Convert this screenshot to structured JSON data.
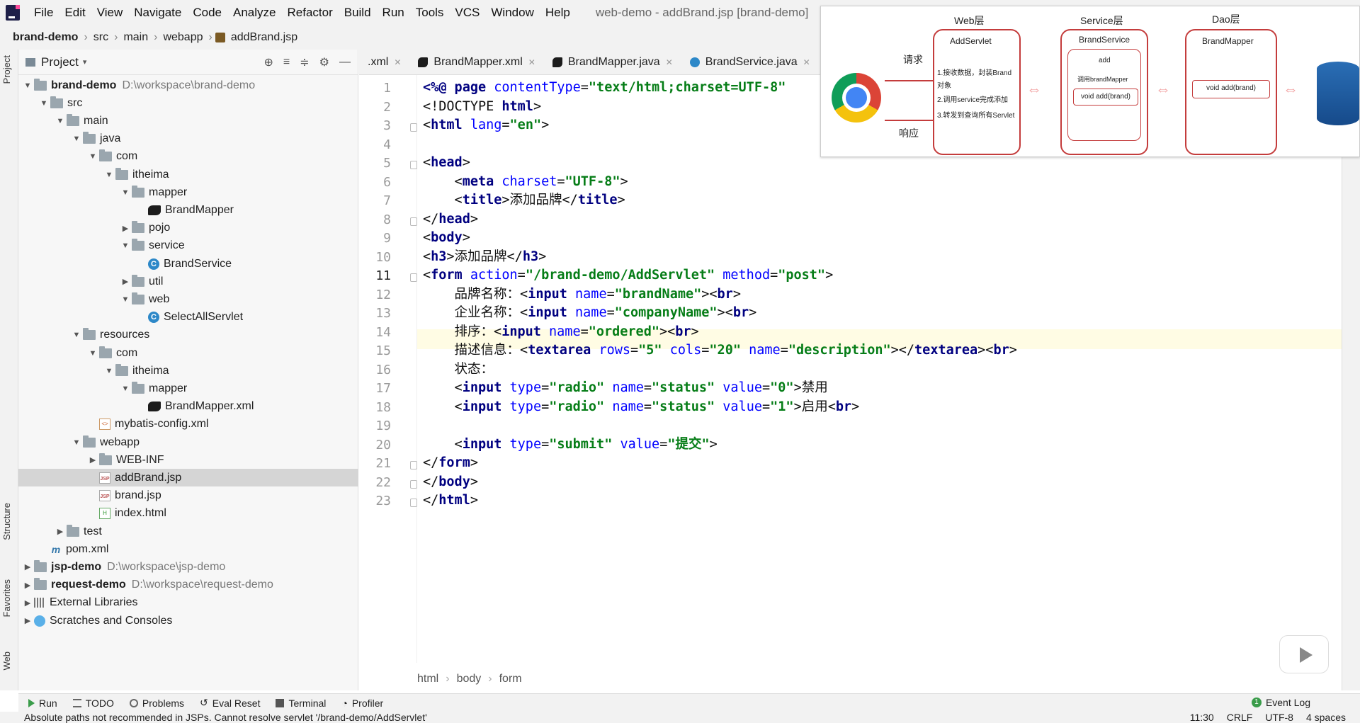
{
  "menubar": {
    "items": [
      "File",
      "Edit",
      "View",
      "Navigate",
      "Code",
      "Analyze",
      "Refactor",
      "Build",
      "Run",
      "Tools",
      "VCS",
      "Window",
      "Help"
    ],
    "window_title": "web-demo - addBrand.jsp [brand-demo]"
  },
  "navbar": {
    "crumbs": [
      "brand-demo",
      "src",
      "main",
      "webapp",
      "addBrand.jsp"
    ]
  },
  "left_stripe": {
    "labels": [
      "Project",
      "Structure",
      "Favorites",
      "Web"
    ]
  },
  "project": {
    "title": "Project",
    "tree": [
      {
        "label": "brand-demo",
        "muted": "D:\\workspace\\brand-demo",
        "icon": "folder",
        "depth": 0,
        "arrow": "down",
        "bold": true
      },
      {
        "label": "src",
        "icon": "folder",
        "depth": 1,
        "arrow": "down"
      },
      {
        "label": "main",
        "icon": "folder",
        "depth": 2,
        "arrow": "down"
      },
      {
        "label": "java",
        "icon": "folder",
        "depth": 3,
        "arrow": "down"
      },
      {
        "label": "com",
        "icon": "folder",
        "depth": 4,
        "arrow": "down"
      },
      {
        "label": "itheima",
        "icon": "folder",
        "depth": 5,
        "arrow": "down"
      },
      {
        "label": "mapper",
        "icon": "folder",
        "depth": 6,
        "arrow": "down"
      },
      {
        "label": "BrandMapper",
        "icon": "bird",
        "depth": 7,
        "arrow": ""
      },
      {
        "label": "pojo",
        "icon": "folder",
        "depth": 6,
        "arrow": "right"
      },
      {
        "label": "service",
        "icon": "folder",
        "depth": 6,
        "arrow": "down"
      },
      {
        "label": "BrandService",
        "icon": "class",
        "depth": 7,
        "arrow": ""
      },
      {
        "label": "util",
        "icon": "folder",
        "depth": 6,
        "arrow": "right"
      },
      {
        "label": "web",
        "icon": "folder",
        "depth": 6,
        "arrow": "down"
      },
      {
        "label": "SelectAllServlet",
        "icon": "class",
        "depth": 7,
        "arrow": ""
      },
      {
        "label": "resources",
        "icon": "folder",
        "depth": 3,
        "arrow": "down"
      },
      {
        "label": "com",
        "icon": "folder",
        "depth": 4,
        "arrow": "down"
      },
      {
        "label": "itheima",
        "icon": "folder",
        "depth": 5,
        "arrow": "down"
      },
      {
        "label": "mapper",
        "icon": "folder",
        "depth": 6,
        "arrow": "down"
      },
      {
        "label": "BrandMapper.xml",
        "icon": "bird",
        "depth": 7,
        "arrow": ""
      },
      {
        "label": "mybatis-config.xml",
        "icon": "xml",
        "depth": 4,
        "arrow": ""
      },
      {
        "label": "webapp",
        "icon": "folder",
        "depth": 3,
        "arrow": "down"
      },
      {
        "label": "WEB-INF",
        "icon": "folder",
        "depth": 4,
        "arrow": "right"
      },
      {
        "label": "addBrand.jsp",
        "icon": "jsp",
        "depth": 4,
        "arrow": "",
        "selected": true
      },
      {
        "label": "brand.jsp",
        "icon": "jsp",
        "depth": 4,
        "arrow": ""
      },
      {
        "label": "index.html",
        "icon": "html",
        "depth": 4,
        "arrow": ""
      },
      {
        "label": "test",
        "icon": "folder",
        "depth": 2,
        "arrow": "right"
      },
      {
        "label": "pom.xml",
        "icon": "m",
        "depth": 1,
        "arrow": ""
      },
      {
        "label": "jsp-demo",
        "muted": "D:\\workspace\\jsp-demo",
        "icon": "folder",
        "depth": 0,
        "arrow": "right",
        "bold": true
      },
      {
        "label": "request-demo",
        "muted": "D:\\workspace\\request-demo",
        "icon": "folder",
        "depth": 0,
        "arrow": "right",
        "bold": true
      },
      {
        "label": "External Libraries",
        "icon": "lib",
        "depth": 0,
        "arrow": "right"
      },
      {
        "label": "Scratches and Consoles",
        "icon": "scratch",
        "depth": 0,
        "arrow": "right"
      }
    ]
  },
  "tabs": [
    {
      "label": ".xml"
    },
    {
      "label": "BrandMapper.xml"
    },
    {
      "label": "BrandMapper.java"
    },
    {
      "label": "BrandService.java"
    }
  ],
  "editor": {
    "current_line": 11,
    "lines": [
      [
        [
          "tag",
          "<%@ page "
        ],
        [
          "attr",
          "contentType"
        ],
        [
          "txt",
          "="
        ],
        [
          "val",
          "\"text/html;charset=UTF-8\""
        ]
      ],
      [
        [
          "txt",
          "<!DOCTYPE "
        ],
        [
          "tag",
          "html"
        ],
        [
          "txt",
          ">"
        ]
      ],
      [
        [
          "txt",
          "<"
        ],
        [
          "tag",
          "html "
        ],
        [
          "attr",
          "lang"
        ],
        [
          "txt",
          "="
        ],
        [
          "val",
          "\"en\""
        ],
        [
          "txt",
          ">"
        ]
      ],
      [],
      [
        [
          "txt",
          "<"
        ],
        [
          "tag",
          "head"
        ],
        [
          "txt",
          ">"
        ]
      ],
      [
        [
          "txt",
          "    <"
        ],
        [
          "tag",
          "meta "
        ],
        [
          "attr",
          "charset"
        ],
        [
          "txt",
          "="
        ],
        [
          "val",
          "\"UTF-8\""
        ],
        [
          "txt",
          ">"
        ]
      ],
      [
        [
          "txt",
          "    <"
        ],
        [
          "tag",
          "title"
        ],
        [
          "txt",
          ">添加品牌</"
        ],
        [
          "tag",
          "title"
        ],
        [
          "txt",
          ">"
        ]
      ],
      [
        [
          "txt",
          "</"
        ],
        [
          "tag",
          "head"
        ],
        [
          "txt",
          ">"
        ]
      ],
      [
        [
          "txt",
          "<"
        ],
        [
          "tag",
          "body"
        ],
        [
          "txt",
          ">"
        ]
      ],
      [
        [
          "txt",
          "<"
        ],
        [
          "tag",
          "h3"
        ],
        [
          "txt",
          ">添加品牌</"
        ],
        [
          "tag",
          "h3"
        ],
        [
          "txt",
          ">"
        ]
      ],
      [
        [
          "txt",
          "<"
        ],
        [
          "tag",
          "form "
        ],
        [
          "attr",
          "action"
        ],
        [
          "txt",
          "="
        ],
        [
          "val",
          "\"/brand-demo/AddServlet\""
        ],
        [
          "txt",
          " "
        ],
        [
          "attr",
          "method"
        ],
        [
          "txt",
          "="
        ],
        [
          "val",
          "\"post\""
        ],
        [
          "txt",
          ">"
        ]
      ],
      [
        [
          "txt",
          "    品牌名称：<"
        ],
        [
          "tag",
          "input "
        ],
        [
          "attr",
          "name"
        ],
        [
          "txt",
          "="
        ],
        [
          "val",
          "\"brandName\""
        ],
        [
          "txt",
          "><"
        ],
        [
          "tag",
          "br"
        ],
        [
          "txt",
          ">"
        ]
      ],
      [
        [
          "txt",
          "    企业名称：<"
        ],
        [
          "tag",
          "input "
        ],
        [
          "attr",
          "name"
        ],
        [
          "txt",
          "="
        ],
        [
          "val",
          "\"companyName\""
        ],
        [
          "txt",
          "><"
        ],
        [
          "tag",
          "br"
        ],
        [
          "txt",
          ">"
        ]
      ],
      [
        [
          "txt",
          "    排序：<"
        ],
        [
          "tag",
          "input "
        ],
        [
          "attr",
          "name"
        ],
        [
          "txt",
          "="
        ],
        [
          "val",
          "\"ordered\""
        ],
        [
          "txt",
          "><"
        ],
        [
          "tag",
          "br"
        ],
        [
          "txt",
          ">"
        ]
      ],
      [
        [
          "txt",
          "    描述信息：<"
        ],
        [
          "tag",
          "textarea "
        ],
        [
          "attr",
          "rows"
        ],
        [
          "txt",
          "="
        ],
        [
          "val",
          "\"5\""
        ],
        [
          "txt",
          " "
        ],
        [
          "attr",
          "cols"
        ],
        [
          "txt",
          "="
        ],
        [
          "val",
          "\"20\""
        ],
        [
          "txt",
          " "
        ],
        [
          "attr",
          "name"
        ],
        [
          "txt",
          "="
        ],
        [
          "val",
          "\"description\""
        ],
        [
          "txt",
          "></"
        ],
        [
          "tag",
          "textarea"
        ],
        [
          "txt",
          "><"
        ],
        [
          "tag",
          "br"
        ],
        [
          "txt",
          ">"
        ]
      ],
      [
        [
          "txt",
          "    状态："
        ]
      ],
      [
        [
          "txt",
          "    <"
        ],
        [
          "tag",
          "input "
        ],
        [
          "attr",
          "type"
        ],
        [
          "txt",
          "="
        ],
        [
          "val",
          "\"radio\""
        ],
        [
          "txt",
          " "
        ],
        [
          "attr",
          "name"
        ],
        [
          "txt",
          "="
        ],
        [
          "val",
          "\"status\""
        ],
        [
          "txt",
          " "
        ],
        [
          "attr",
          "value"
        ],
        [
          "txt",
          "="
        ],
        [
          "val",
          "\"0\""
        ],
        [
          "txt",
          ">禁用"
        ]
      ],
      [
        [
          "txt",
          "    <"
        ],
        [
          "tag",
          "input "
        ],
        [
          "attr",
          "type"
        ],
        [
          "txt",
          "="
        ],
        [
          "val",
          "\"radio\""
        ],
        [
          "txt",
          " "
        ],
        [
          "attr",
          "name"
        ],
        [
          "txt",
          "="
        ],
        [
          "val",
          "\"status\""
        ],
        [
          "txt",
          " "
        ],
        [
          "attr",
          "value"
        ],
        [
          "txt",
          "="
        ],
        [
          "val",
          "\"1\""
        ],
        [
          "txt",
          ">启用<"
        ],
        [
          "tag",
          "br"
        ],
        [
          "txt",
          ">"
        ]
      ],
      [],
      [
        [
          "txt",
          "    <"
        ],
        [
          "tag",
          "input "
        ],
        [
          "attr",
          "type"
        ],
        [
          "txt",
          "="
        ],
        [
          "val",
          "\"submit\""
        ],
        [
          "txt",
          " "
        ],
        [
          "attr",
          "value"
        ],
        [
          "txt",
          "="
        ],
        [
          "val",
          "\"提交\""
        ],
        [
          "txt",
          ">"
        ]
      ],
      [
        [
          "txt",
          "</"
        ],
        [
          "tag",
          "form"
        ],
        [
          "txt",
          ">"
        ]
      ],
      [
        [
          "txt",
          "</"
        ],
        [
          "tag",
          "body"
        ],
        [
          "txt",
          ">"
        ]
      ],
      [
        [
          "txt",
          "</"
        ],
        [
          "tag",
          "html"
        ],
        [
          "txt",
          ">"
        ]
      ]
    ],
    "breadcrumb": [
      "html",
      "body",
      "form"
    ]
  },
  "overlay": {
    "web_layer": "Web层",
    "service_layer": "Service层",
    "dao_layer": "Dao层",
    "request": "请求",
    "response": "响应",
    "add_servlet": "AddServlet",
    "servlet_steps": [
      "1.接收数据，封装Brand",
      "对象",
      "2.调用service完成添加",
      "3.转发到查询所有Servlet"
    ],
    "brand_service": "BrandService",
    "service_add": "add",
    "service_call": "调用brandMapper",
    "service_method": "void add(brand)",
    "brand_mapper": "BrandMapper",
    "mapper_method": "void add(brand)"
  },
  "toolwindows": [
    "Run",
    "TODO",
    "Problems",
    "Eval Reset",
    "Terminal",
    "Profiler"
  ],
  "event_log": "Event Log",
  "status": {
    "message": "Absolute paths not recommended in JSPs. Cannot resolve servlet '/brand-demo/AddServlet'",
    "position": "11:30",
    "line_sep": "CRLF",
    "encoding": "UTF-8",
    "indent": "4 spaces"
  },
  "colors": {
    "accent": "#c43c3c",
    "current_line": "#fffce4",
    "selection": "#d5d5d5"
  }
}
